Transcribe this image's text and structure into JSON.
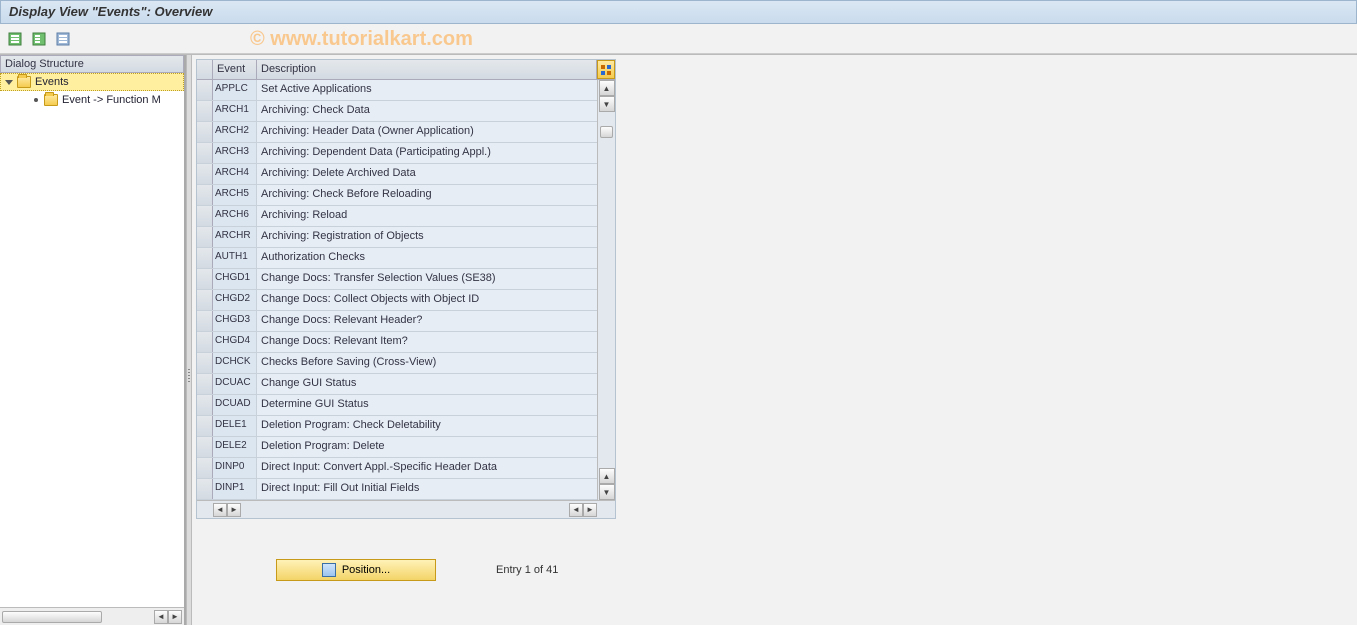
{
  "window": {
    "title": "Display View \"Events\": Overview"
  },
  "toolbar": [
    {
      "name": "expand-all-icon",
      "color": "#4a9b4a"
    },
    {
      "name": "collapse-all-icon",
      "color": "#4a9b4a"
    },
    {
      "name": "print-icon",
      "color": "#6a7fa5"
    }
  ],
  "watermark": "© www.tutorialkart.com",
  "sidebar": {
    "title": "Dialog Structure",
    "root": {
      "label": "Events",
      "expanded": true,
      "selected": true
    },
    "child": {
      "label": "Event -> Function M"
    }
  },
  "grid": {
    "headers": {
      "event": "Event",
      "description": "Description"
    },
    "rows": [
      {
        "event": "APPLC",
        "desc": "Set Active Applications"
      },
      {
        "event": "ARCH1",
        "desc": "Archiving: Check Data"
      },
      {
        "event": "ARCH2",
        "desc": "Archiving: Header Data (Owner Application)"
      },
      {
        "event": "ARCH3",
        "desc": "Archiving: Dependent Data (Participating Appl.)"
      },
      {
        "event": "ARCH4",
        "desc": "Archiving: Delete Archived Data"
      },
      {
        "event": "ARCH5",
        "desc": "Archiving: Check Before Reloading"
      },
      {
        "event": "ARCH6",
        "desc": "Archiving: Reload"
      },
      {
        "event": "ARCHR",
        "desc": "Archiving: Registration of Objects"
      },
      {
        "event": "AUTH1",
        "desc": "Authorization Checks"
      },
      {
        "event": "CHGD1",
        "desc": "Change Docs: Transfer Selection Values (SE38)"
      },
      {
        "event": "CHGD2",
        "desc": "Change Docs: Collect Objects with Object ID"
      },
      {
        "event": "CHGD3",
        "desc": "Change Docs: Relevant Header?"
      },
      {
        "event": "CHGD4",
        "desc": "Change Docs: Relevant Item?"
      },
      {
        "event": "DCHCK",
        "desc": "Checks Before Saving (Cross-View)"
      },
      {
        "event": "DCUAC",
        "desc": "Change GUI Status"
      },
      {
        "event": "DCUAD",
        "desc": "Determine GUI Status"
      },
      {
        "event": "DELE1",
        "desc": "Deletion Program: Check Deletability"
      },
      {
        "event": "DELE2",
        "desc": "Deletion Program: Delete"
      },
      {
        "event": "DINP0",
        "desc": "Direct Input: Convert Appl.-Specific Header Data"
      },
      {
        "event": "DINP1",
        "desc": "Direct Input: Fill Out Initial Fields"
      }
    ]
  },
  "footer": {
    "position_label": "Position...",
    "entry_text": "Entry 1 of 41"
  }
}
